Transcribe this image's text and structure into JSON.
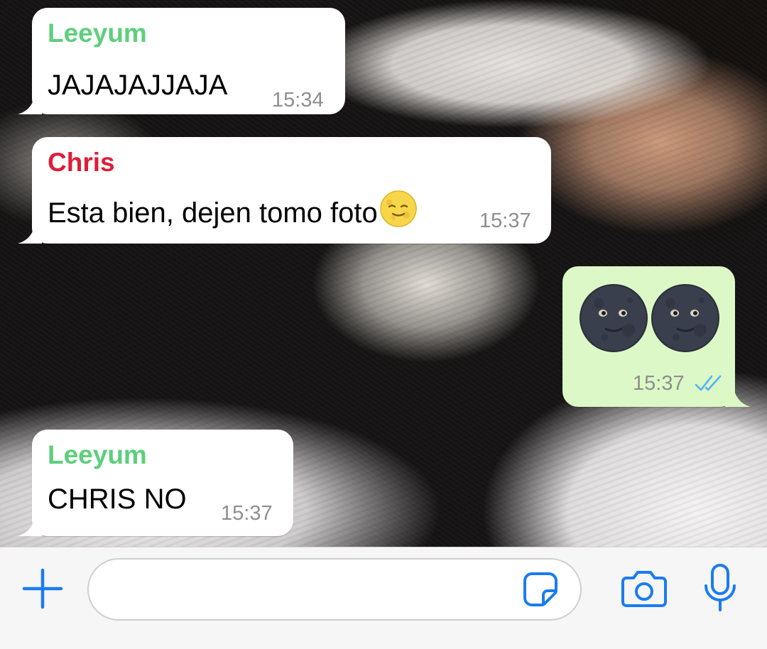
{
  "colors": {
    "accent": "#1a7cf0",
    "incoming_bubble": "#ffffff",
    "outgoing_bubble": "#dcf8c6",
    "timestamp": "#8e8e8e",
    "read_ticks": "#4fb3f6",
    "input_bar": "#f6f6f6"
  },
  "messages": [
    {
      "direction": "incoming",
      "sender": "Leeyum",
      "sender_color": "#5ecf7d",
      "text": "JAJAJAJJAJA",
      "time": "15:34"
    },
    {
      "direction": "incoming",
      "sender": "Chris",
      "sender_color": "#dc1e38",
      "text": "Esta bien, dejen tomo foto",
      "emoji": "full-moon-face",
      "time": "15:37"
    },
    {
      "direction": "outgoing",
      "emoji": [
        "new-moon-face",
        "new-moon-face"
      ],
      "time": "15:37",
      "status": "read"
    },
    {
      "direction": "incoming",
      "sender": "Leeyum",
      "sender_color": "#5ecf7d",
      "text": "CHRIS NO",
      "time": "15:37"
    }
  ],
  "input_bar": {
    "attach_icon": "plus-icon",
    "sticker_icon": "sticker-icon",
    "camera_icon": "camera-icon",
    "mic_icon": "microphone-icon",
    "text_value": ""
  }
}
